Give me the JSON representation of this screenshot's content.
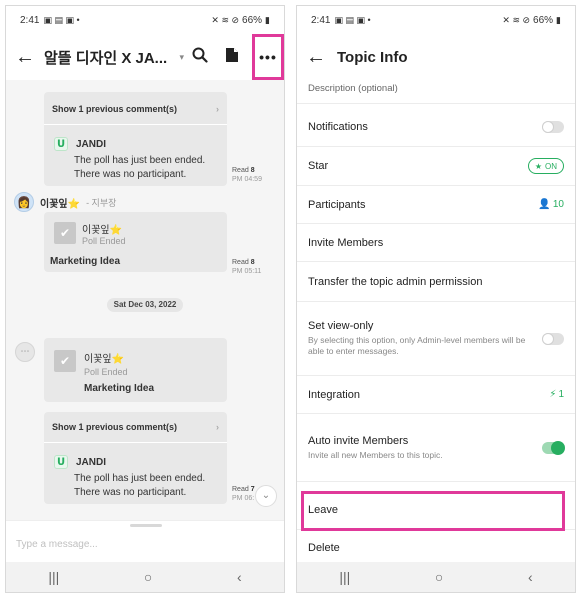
{
  "left": {
    "status": {
      "time": "2:41",
      "battery": "66%"
    },
    "header": {
      "title": "알뜰 디자인 X JA...",
      "more_label": "•••"
    },
    "chat": {
      "show_prev_1": "Show 1 previous comment(s)",
      "jandi_1": {
        "name": "JANDI",
        "line1": "The poll has just been ended.",
        "line2": "There was no participant."
      },
      "read_1": {
        "label": "Read",
        "count": "8",
        "time": "PM 04:59"
      },
      "sender": {
        "name": "이꽃잎⭐",
        "role": "- 지부장"
      },
      "poll_1": {
        "name": "이꽃잎⭐",
        "status": "Poll Ended",
        "title": "Marketing Idea"
      },
      "read_2": {
        "label": "Read",
        "count": "8",
        "time": "PM 05:11"
      },
      "date": "Sat Dec 03, 2022",
      "poll_2": {
        "name": "이꽃잎⭐",
        "status": "Poll Ended",
        "title": "Marketing Idea"
      },
      "show_prev_2": "Show 1 previous comment(s)",
      "jandi_2": {
        "name": "JANDI",
        "line1": "The poll has just been ended.",
        "line2": "There was no participant."
      },
      "read_3": {
        "label": "Read",
        "count": "7",
        "time": "PM 06:"
      }
    },
    "input": {
      "placeholder": "Type a message..."
    }
  },
  "right": {
    "status": {
      "time": "2:41",
      "battery": "66%"
    },
    "header": {
      "title": "Topic Info"
    },
    "description_label": "Description (optional)",
    "rows": {
      "notifications": "Notifications",
      "star": "Star",
      "star_chip": "ON",
      "participants": "Participants",
      "participants_count": "10",
      "invite_members": "Invite Members",
      "transfer_admin": "Transfer the topic admin permission",
      "set_view_only": "Set view-only",
      "set_view_only_desc": "By selecting this option, only Admin-level members will be able to enter messages.",
      "integration": "Integration",
      "integration_count": "1",
      "auto_invite": "Auto invite Members",
      "auto_invite_desc": "Invite all new Members to this topic.",
      "leave": "Leave",
      "delete": "Delete"
    }
  },
  "colors": {
    "accent_green": "#27ae60",
    "highlight": "#e0399a"
  }
}
